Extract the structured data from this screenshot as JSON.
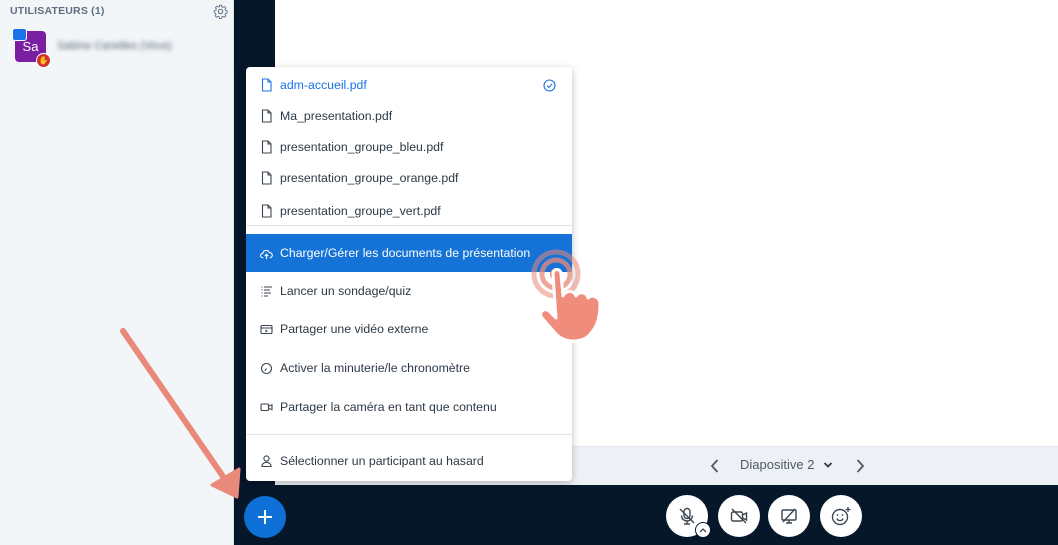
{
  "users": {
    "title": "UTILISATEURS (1)",
    "user": {
      "initials": "Sa",
      "name": "Sabine Canelles (Vous)"
    }
  },
  "menu": {
    "items": [
      {
        "label": "adm-accueil.pdf",
        "icon": "file-icon",
        "current": true
      },
      {
        "label": "Ma_presentation.pdf",
        "icon": "file-icon"
      },
      {
        "label": "presentation_groupe_bleu.pdf",
        "icon": "file-icon"
      },
      {
        "label": "presentation_groupe_orange.pdf",
        "icon": "file-icon"
      },
      {
        "label": "presentation_groupe_vert.pdf",
        "icon": "file-icon"
      },
      {
        "label": "Charger/Gérer les documents de présentation",
        "icon": "upload-cloud-icon"
      },
      {
        "label": "Lancer un sondage/quiz",
        "icon": "poll-icon"
      },
      {
        "label": "Partager une vidéo externe",
        "icon": "external-video-icon"
      },
      {
        "label": "Activer la minuterie/le chronomètre",
        "icon": "timer-icon"
      },
      {
        "label": "Partager la caméra en tant que contenu",
        "icon": "camera-content-icon"
      },
      {
        "label": "Sélectionner un participant au hasard",
        "icon": "user-icon"
      }
    ]
  },
  "slide_toolbar": {
    "slide_label": "Diapositive 2"
  },
  "colors": {
    "accent": "#1572D7",
    "dark_background": "#06172A",
    "avatar": "#7B1FA2",
    "annotation": "#E8897A"
  }
}
